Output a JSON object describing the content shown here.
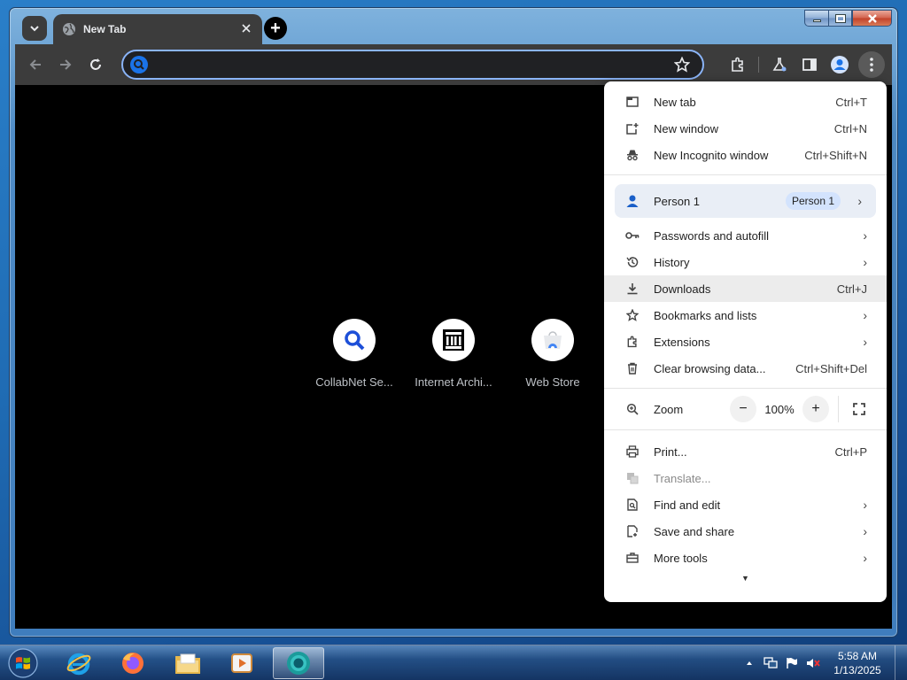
{
  "browser": {
    "tab": {
      "title": "New Tab"
    },
    "new_tab_symbol": "+",
    "omnibox": {
      "value": "",
      "placeholder": ""
    }
  },
  "shortcuts": [
    {
      "label": "CollabNet Se...",
      "icon": "magnifier-icon"
    },
    {
      "label": "Internet Archi...",
      "icon": "archive-building-icon"
    },
    {
      "label": "Web Store",
      "icon": "webstore-icon"
    }
  ],
  "menu": {
    "new_tab": {
      "label": "New tab",
      "shortcut": "Ctrl+T"
    },
    "new_window": {
      "label": "New window",
      "shortcut": "Ctrl+N"
    },
    "new_incognito": {
      "label": "New Incognito window",
      "shortcut": "Ctrl+Shift+N"
    },
    "profile": {
      "label": "Person 1",
      "badge": "Person 1"
    },
    "passwords": {
      "label": "Passwords and autofill"
    },
    "history": {
      "label": "History"
    },
    "downloads": {
      "label": "Downloads",
      "shortcut": "Ctrl+J"
    },
    "bookmarks": {
      "label": "Bookmarks and lists"
    },
    "extensions": {
      "label": "Extensions"
    },
    "clear_data": {
      "label": "Clear browsing data...",
      "shortcut": "Ctrl+Shift+Del"
    },
    "zoom": {
      "label": "Zoom",
      "value": "100%",
      "minus": "−",
      "plus": "+"
    },
    "print": {
      "label": "Print...",
      "shortcut": "Ctrl+P"
    },
    "translate": {
      "label": "Translate..."
    },
    "find_edit": {
      "label": "Find and edit"
    },
    "save_share": {
      "label": "Save and share"
    },
    "more_tools": {
      "label": "More tools"
    },
    "arrow": "›",
    "more_indicator": "▼"
  },
  "taskbar": {
    "apps": [
      "internet-explorer-icon",
      "firefox-icon",
      "file-explorer-icon",
      "media-player-icon",
      "chrome-icon"
    ],
    "clock": {
      "time": "5:58 AM",
      "date": "1/13/2025"
    }
  },
  "colors": {
    "omnibox_focus": "#8ab4f8",
    "toolbar": "#3c3c3c",
    "profile_row": "#e9eef6",
    "profile_badge": "#d3e3fd",
    "accent_blue": "#1a73e8"
  }
}
